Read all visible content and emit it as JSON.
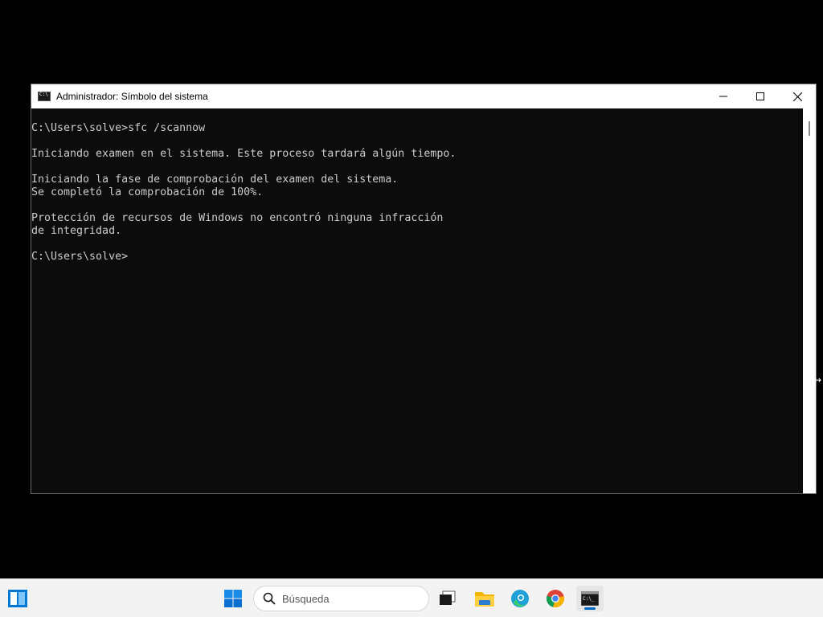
{
  "window": {
    "title": "Administrador: Símbolo del sistema",
    "controls": [
      "minimize-icon",
      "maximize-icon",
      "close-icon"
    ]
  },
  "console": {
    "lines": [
      "C:\\Users\\solve>sfc /scannow",
      "",
      "Iniciando examen en el sistema. Este proceso tardará algún tiempo.",
      "",
      "Iniciando la fase de comprobación del examen del sistema.",
      "Se completó la comprobación de 100%.",
      "",
      "Protección de recursos de Windows no encontró ninguna infracción",
      "de integridad.",
      "",
      "C:\\Users\\solve>"
    ]
  },
  "taskbar": {
    "search_placeholder": "Búsqueda",
    "icons": [
      "widgets-icon",
      "windows-start-icon",
      "search-icon",
      "task-view-icon",
      "file-explorer-icon",
      "edge-icon",
      "chrome-icon",
      "command-prompt-icon"
    ],
    "accent": "#0067c0"
  }
}
